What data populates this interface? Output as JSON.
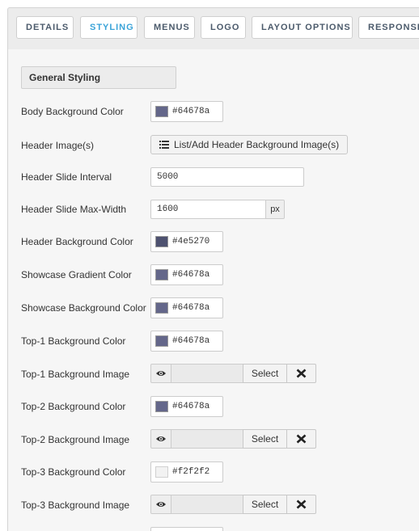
{
  "tabs": [
    {
      "label": "DETAILS",
      "active": false
    },
    {
      "label": "STYLING",
      "active": true
    },
    {
      "label": "MENUS",
      "active": false
    },
    {
      "label": "LOGO",
      "active": false
    },
    {
      "label": "LAYOUT OPTIONS",
      "active": false
    },
    {
      "label": "RESPONSIVE",
      "active": false
    }
  ],
  "section": {
    "title": "General Styling"
  },
  "fields": {
    "body_bg": {
      "label": "Body Background Color",
      "value": "#64678a",
      "color": "#64678a"
    },
    "header_images": {
      "label": "Header Image(s)",
      "button": "List/Add Header Background Image(s)",
      "icon": "list-icon"
    },
    "slide_interval": {
      "label": "Header Slide Interval",
      "value": "5000"
    },
    "slide_max_width": {
      "label": "Header Slide Max-Width",
      "value": "1600",
      "unit": "px"
    },
    "header_bg": {
      "label": "Header Background Color",
      "value": "#4e5270",
      "color": "#4e5270"
    },
    "showcase_gradient": {
      "label": "Showcase Gradient Color",
      "value": "#64678a",
      "color": "#64678a"
    },
    "showcase_bg": {
      "label": "Showcase Background Color",
      "value": "#64678a",
      "color": "#64678a"
    },
    "top1_bg": {
      "label": "Top-1 Background Color",
      "value": "#64678a",
      "color": "#64678a"
    },
    "top1_img": {
      "label": "Top-1 Background Image",
      "select": "Select",
      "icons": [
        "eye-icon",
        "close-x-icon"
      ]
    },
    "top2_bg": {
      "label": "Top-2 Background Color",
      "value": "#64678a",
      "color": "#64678a"
    },
    "top2_img": {
      "label": "Top-2 Background Image",
      "select": "Select",
      "icons": [
        "eye-icon",
        "close-x-icon"
      ]
    },
    "top3_bg": {
      "label": "Top-3 Background Color",
      "value": "#f2f2f2",
      "color": "#f2f2f2"
    },
    "top3_img": {
      "label": "Top-3 Background Image",
      "select": "Select",
      "icons": [
        "eye-icon",
        "close-x-icon"
      ]
    }
  }
}
